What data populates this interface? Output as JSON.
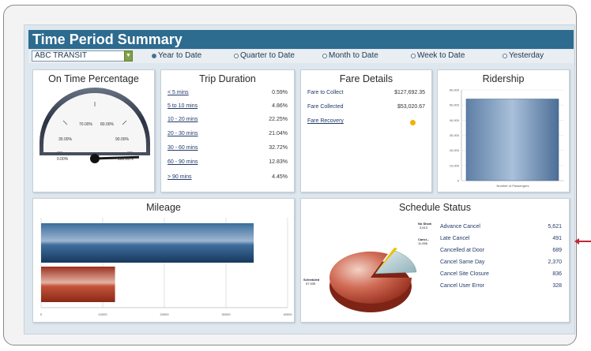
{
  "title": "Time Period Summary",
  "filters": {
    "agency": "ABC TRANSIT",
    "periods": [
      "Year to Date",
      "Quarter to Date",
      "Month to Date",
      "Week to Date",
      "Yesterday"
    ],
    "selected": "Year to Date"
  },
  "on_time": {
    "title": "On Time Percentage",
    "gauge_labels": [
      "0.00%",
      "30.00%",
      "70.00%",
      "80.00%",
      "90.00%",
      "100.00%"
    ],
    "value_percent": 99
  },
  "trip_duration": {
    "title": "Trip Duration",
    "rows": [
      {
        "label": "< 5 mins",
        "value": "0.59%"
      },
      {
        "label": "5 to 10 mins",
        "value": "4.86%"
      },
      {
        "label": "10 - 20 mins",
        "value": "22.25%"
      },
      {
        "label": "20 - 30 mins",
        "value": "21.04%"
      },
      {
        "label": "30 - 60 mins",
        "value": "32.72%"
      },
      {
        "label": "60 - 90 mins",
        "value": "12.83%"
      },
      {
        "label": "> 90 mins",
        "value": "4.45%"
      }
    ]
  },
  "fare": {
    "title": "Fare Details",
    "rows": [
      {
        "label": "Fare to Collect",
        "value": "$127,692.35"
      },
      {
        "label": "Fare Collected",
        "value": "$53,020.67"
      },
      {
        "label": "Fare Recovery",
        "value": ""
      }
    ],
    "status_color": "#f0b400"
  },
  "ridership": {
    "title": "Ridership",
    "y_ticks": [
      "60,000",
      "50,000",
      "40,000",
      "30,000",
      "20,000",
      "10,000",
      "0"
    ],
    "x_label": "Number of Passengers",
    "value": 54000,
    "ymax": 60000
  },
  "mileage": {
    "title": "Mileage",
    "x_ticks": [
      "0",
      "10000",
      "20000",
      "30000",
      "40000"
    ],
    "xmax": 40000,
    "bars": [
      {
        "value": 34500,
        "color": "#1e4c7a"
      },
      {
        "value": 12000,
        "color": "#b6422c"
      }
    ]
  },
  "schedule": {
    "title": "Schedule Status",
    "pie_labels": {
      "no_show": "No Show",
      "no_show_value": "3,613",
      "cancel": "Cancl...",
      "cancel_value": "11,956",
      "scheduled": "Scheduled",
      "scheduled_value": "57,935"
    },
    "rows": [
      {
        "label": "Advance Cancel",
        "value": "5,621"
      },
      {
        "label": "Late Cancel",
        "value": "491"
      },
      {
        "label": "Cancelled at Door",
        "value": "689"
      },
      {
        "label": "Cancel Same Day",
        "value": "2,370"
      },
      {
        "label": "Cancel Site Closure",
        "value": "836"
      },
      {
        "label": "Cancel User Error",
        "value": "328"
      }
    ]
  }
}
